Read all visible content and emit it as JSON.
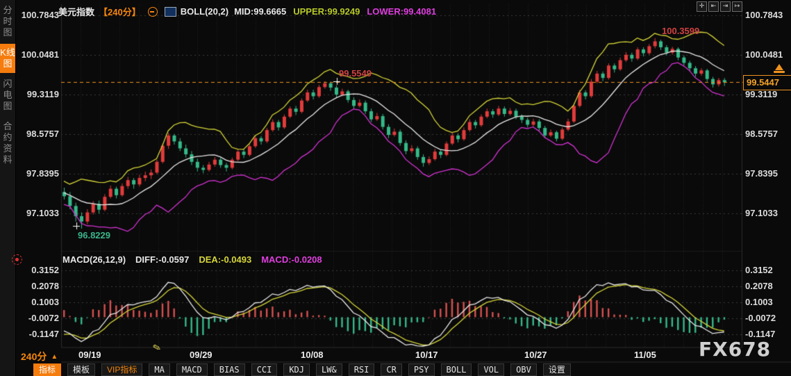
{
  "header": {
    "title": "美元指数",
    "period": "【240分】",
    "boll_label": "BOLL(20,2)",
    "mid": "MID:99.6665",
    "upper": "UPPER:99.9249",
    "lower": "LOWER:99.4081"
  },
  "macd_header": {
    "label": "MACD(26,12,9)",
    "diff": "DIFF:-0.0597",
    "dea": "DEA:-0.0493",
    "macd": "MACD:-0.0208"
  },
  "sidebar": {
    "items": [
      {
        "label": "分时图",
        "active": false
      },
      {
        "label": "K线图",
        "active": true
      },
      {
        "label": "闪电图",
        "active": false
      },
      {
        "label": "合约资料",
        "active": false
      }
    ]
  },
  "footer": {
    "timeframe": "240分",
    "arrow": "▲"
  },
  "watermark": "FX678",
  "window_buttons": {
    "b1": "✛",
    "b2": "⇤",
    "b3": "⇥",
    "b4": "↦"
  },
  "toolbar": {
    "items": [
      {
        "label": "指标"
      },
      {
        "label": "模板"
      },
      {
        "label": "VIP指标"
      },
      {
        "label": "MA"
      },
      {
        "label": "MACD"
      },
      {
        "label": "BIAS"
      },
      {
        "label": "CCI"
      },
      {
        "label": "KDJ"
      },
      {
        "label": "LW&"
      },
      {
        "label": "RSI"
      },
      {
        "label": "CR"
      },
      {
        "label": "PSY"
      },
      {
        "label": "BOLL"
      },
      {
        "label": "VOL"
      },
      {
        "label": "OBV"
      },
      {
        "label": "设置"
      }
    ]
  },
  "chart_data": {
    "type": "candlestick",
    "symbol": "美元指数",
    "period": "240分",
    "x_labels": [
      "09/19",
      "09/29",
      "10/08",
      "10/17",
      "10/27",
      "11/05"
    ],
    "main": {
      "y_ticks": [
        "100.7843",
        "100.0481",
        "99.3119",
        "98.5757",
        "97.8395",
        "97.1033"
      ],
      "y_range": [
        100.7843,
        97.1033
      ],
      "boll": {
        "params": "BOLL(20,2)",
        "mid": 99.6665,
        "upper": 99.9249,
        "lower": 99.4081
      },
      "markers": {
        "high": "100.3599",
        "swing_high": "99.5549",
        "low": "96.8229",
        "last_price": "99.5447"
      },
      "colors": {
        "up": "#e23b3b",
        "down": "#35b989",
        "mid_band": "#e8e8e8",
        "upper_band": "#d4d438",
        "lower_band": "#d232d2",
        "price_line": "#f0921e"
      },
      "ohlc": [
        [
          97.5,
          97.58,
          97.36,
          97.42
        ],
        [
          97.42,
          97.5,
          97.18,
          97.24
        ],
        [
          97.24,
          97.3,
          96.95,
          97.05
        ],
        [
          97.05,
          97.12,
          96.82,
          96.95
        ],
        [
          96.95,
          97.18,
          96.9,
          97.12
        ],
        [
          97.12,
          97.33,
          97.08,
          97.28
        ],
        [
          97.28,
          97.34,
          97.1,
          97.17
        ],
        [
          97.17,
          97.46,
          97.14,
          97.41
        ],
        [
          97.41,
          97.62,
          97.38,
          97.56
        ],
        [
          97.56,
          97.6,
          97.38,
          97.44
        ],
        [
          97.44,
          97.66,
          97.41,
          97.61
        ],
        [
          97.61,
          97.78,
          97.56,
          97.72
        ],
        [
          97.72,
          97.76,
          97.56,
          97.64
        ],
        [
          97.64,
          97.82,
          97.6,
          97.76
        ],
        [
          97.76,
          97.88,
          97.7,
          97.81
        ],
        [
          97.81,
          97.92,
          97.74,
          97.86
        ],
        [
          97.86,
          98.1,
          97.83,
          98.06
        ],
        [
          98.06,
          98.4,
          98.03,
          98.36
        ],
        [
          98.36,
          98.6,
          98.3,
          98.55
        ],
        [
          98.55,
          98.58,
          98.38,
          98.44
        ],
        [
          98.44,
          98.5,
          98.26,
          98.31
        ],
        [
          98.31,
          98.38,
          98.14,
          98.2
        ],
        [
          98.2,
          98.26,
          98.0,
          98.06
        ],
        [
          98.06,
          98.12,
          97.88,
          97.95
        ],
        [
          97.95,
          98.0,
          97.85,
          97.91
        ],
        [
          97.91,
          98.06,
          97.88,
          98.01
        ],
        [
          98.01,
          98.15,
          97.97,
          98.1
        ],
        [
          98.1,
          98.14,
          97.95,
          98.0
        ],
        [
          98.0,
          98.04,
          97.88,
          97.95
        ],
        [
          97.95,
          98.14,
          97.92,
          98.1
        ],
        [
          98.1,
          98.3,
          98.07,
          98.25
        ],
        [
          98.25,
          98.3,
          98.13,
          98.19
        ],
        [
          98.19,
          98.39,
          98.16,
          98.35
        ],
        [
          98.35,
          98.55,
          98.32,
          98.5
        ],
        [
          98.5,
          98.54,
          98.38,
          98.44
        ],
        [
          98.44,
          98.69,
          98.41,
          98.65
        ],
        [
          98.65,
          98.85,
          98.62,
          98.8
        ],
        [
          98.8,
          98.84,
          98.64,
          98.7
        ],
        [
          98.7,
          98.94,
          98.67,
          98.9
        ],
        [
          98.9,
          99.09,
          98.87,
          99.05
        ],
        [
          99.05,
          99.1,
          98.93,
          98.99
        ],
        [
          98.99,
          99.24,
          98.96,
          99.2
        ],
        [
          99.2,
          99.4,
          99.17,
          99.35
        ],
        [
          99.35,
          99.4,
          99.22,
          99.28
        ],
        [
          99.28,
          99.49,
          99.25,
          99.45
        ],
        [
          99.45,
          99.56,
          99.42,
          99.52
        ],
        [
          99.52,
          99.55,
          99.38,
          99.44
        ],
        [
          99.44,
          99.48,
          99.26,
          99.31
        ],
        [
          99.31,
          99.42,
          99.28,
          99.37
        ],
        [
          99.37,
          99.4,
          99.16,
          99.21
        ],
        [
          99.21,
          99.26,
          99.05,
          99.1
        ],
        [
          99.1,
          99.22,
          99.07,
          99.16
        ],
        [
          99.16,
          99.2,
          98.95,
          99.0
        ],
        [
          99.0,
          99.05,
          98.8,
          98.85
        ],
        [
          98.85,
          98.97,
          98.82,
          98.91
        ],
        [
          98.91,
          98.95,
          98.66,
          98.71
        ],
        [
          98.71,
          98.76,
          98.5,
          98.56
        ],
        [
          98.56,
          98.68,
          98.53,
          98.62
        ],
        [
          98.62,
          98.66,
          98.36,
          98.41
        ],
        [
          98.41,
          98.46,
          98.2,
          98.26
        ],
        [
          98.26,
          98.37,
          98.22,
          98.31
        ],
        [
          98.31,
          98.35,
          98.1,
          98.15
        ],
        [
          98.15,
          98.2,
          97.97,
          98.04
        ],
        [
          98.04,
          98.16,
          98.0,
          98.11
        ],
        [
          98.11,
          98.3,
          98.08,
          98.25
        ],
        [
          98.25,
          98.29,
          98.13,
          98.19
        ],
        [
          98.19,
          98.44,
          98.16,
          98.4
        ],
        [
          98.4,
          98.6,
          98.37,
          98.55
        ],
        [
          98.55,
          98.59,
          98.42,
          98.48
        ],
        [
          98.48,
          98.7,
          98.45,
          98.65
        ],
        [
          98.65,
          98.85,
          98.62,
          98.8
        ],
        [
          98.8,
          98.84,
          98.68,
          98.74
        ],
        [
          98.74,
          98.94,
          98.71,
          98.9
        ],
        [
          98.9,
          99.05,
          98.87,
          99.0
        ],
        [
          99.0,
          99.04,
          98.88,
          98.94
        ],
        [
          98.94,
          99.1,
          98.91,
          99.05
        ],
        [
          99.05,
          99.09,
          98.9,
          98.95
        ],
        [
          98.95,
          99.06,
          98.92,
          99.01
        ],
        [
          99.01,
          99.05,
          98.85,
          98.9
        ],
        [
          98.9,
          98.94,
          98.78,
          98.84
        ],
        [
          98.84,
          98.88,
          98.7,
          98.75
        ],
        [
          98.75,
          98.86,
          98.72,
          98.81
        ],
        [
          98.81,
          98.85,
          98.64,
          98.69
        ],
        [
          98.69,
          98.73,
          98.5,
          98.55
        ],
        [
          98.55,
          98.66,
          98.52,
          98.61
        ],
        [
          98.61,
          98.64,
          98.44,
          98.49
        ],
        [
          98.49,
          98.7,
          98.46,
          98.66
        ],
        [
          98.66,
          98.86,
          98.63,
          98.81
        ],
        [
          98.81,
          99.15,
          98.78,
          99.1
        ],
        [
          99.1,
          99.4,
          99.07,
          99.35
        ],
        [
          99.35,
          99.39,
          99.22,
          99.28
        ],
        [
          99.28,
          99.6,
          99.25,
          99.55
        ],
        [
          99.55,
          99.75,
          99.52,
          99.7
        ],
        [
          99.7,
          99.74,
          99.56,
          99.62
        ],
        [
          99.62,
          99.89,
          99.59,
          99.85
        ],
        [
          99.85,
          99.89,
          99.72,
          99.78
        ],
        [
          99.78,
          100.0,
          99.75,
          99.95
        ],
        [
          99.95,
          100.1,
          99.92,
          100.05
        ],
        [
          100.05,
          100.09,
          99.92,
          99.98
        ],
        [
          99.98,
          100.19,
          99.95,
          100.15
        ],
        [
          100.15,
          100.19,
          100.02,
          100.08
        ],
        [
          100.08,
          100.25,
          100.05,
          100.21
        ],
        [
          100.21,
          100.36,
          100.17,
          100.3
        ],
        [
          100.3,
          100.33,
          100.14,
          100.19
        ],
        [
          100.19,
          100.23,
          100.04,
          100.09
        ],
        [
          100.09,
          100.2,
          100.05,
          100.16
        ],
        [
          100.16,
          100.19,
          99.95,
          100.0
        ],
        [
          100.0,
          100.04,
          99.85,
          99.9
        ],
        [
          99.9,
          99.94,
          99.74,
          99.8
        ],
        [
          99.8,
          99.84,
          99.64,
          99.7
        ],
        [
          99.7,
          99.8,
          99.66,
          99.76
        ],
        [
          99.76,
          99.79,
          99.55,
          99.6
        ],
        [
          99.6,
          99.64,
          99.44,
          99.5
        ],
        [
          99.5,
          99.62,
          99.46,
          99.58
        ],
        [
          99.58,
          99.62,
          99.47,
          99.54
        ]
      ]
    },
    "macd": {
      "params": "MACD(26,12,9)",
      "diff": -0.0597,
      "dea": -0.0493,
      "macd": -0.0208,
      "y_ticks": [
        "0.3152",
        "0.2078",
        "0.1003",
        "-0.0072",
        "-0.1147"
      ],
      "colors": {
        "diff_line": "#e8e8e8",
        "dea_line": "#d6d63a",
        "hist_pos": "#d85050",
        "hist_neg": "#35b989"
      }
    }
  }
}
